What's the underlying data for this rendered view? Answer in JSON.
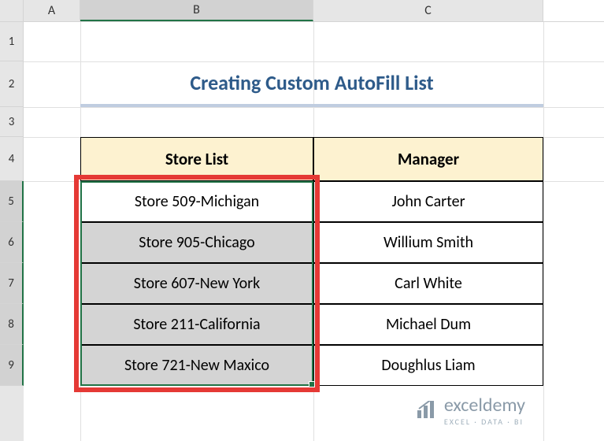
{
  "columns": {
    "a": "A",
    "b": "B",
    "c": "C"
  },
  "rows": {
    "r1": "1",
    "r2": "2",
    "r3": "3",
    "r4": "4",
    "r5": "5",
    "r6": "6",
    "r7": "7",
    "r8": "8",
    "r9": "9"
  },
  "title": "Creating Custom AutoFill List",
  "table": {
    "headers": {
      "store": "Store List",
      "manager": "Manager"
    },
    "rows": [
      {
        "store": "Store 509-Michigan",
        "manager": "John Carter"
      },
      {
        "store": "Store 905-Chicago",
        "manager": "Willium Smith"
      },
      {
        "store": "Store 607-New York",
        "manager": "Carl White"
      },
      {
        "store": "Store 211-California",
        "manager": "Michael Dum"
      },
      {
        "store": "Store 721-New Maxico",
        "manager": "Doughlus Liam"
      }
    ]
  },
  "watermark": {
    "brand": "exceldemy",
    "tagline": "EXCEL · DATA · BI"
  },
  "chart_data": {
    "type": "table",
    "title": "Creating Custom AutoFill List",
    "columns": [
      "Store List",
      "Manager"
    ],
    "rows": [
      [
        "Store 509-Michigan",
        "John Carter"
      ],
      [
        "Store 905-Chicago",
        "Willium Smith"
      ],
      [
        "Store 607-New York",
        "Carl White"
      ],
      [
        "Store 211-California",
        "Michael Dum"
      ],
      [
        "Store 721-New Maxico",
        "Doughlus Liam"
      ]
    ]
  }
}
